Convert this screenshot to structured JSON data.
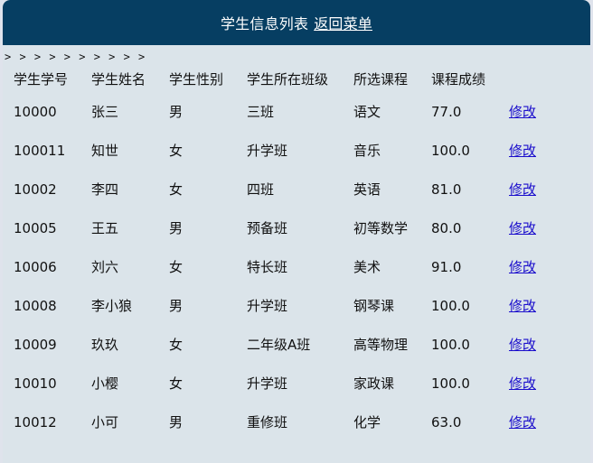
{
  "header": {
    "title": "学生信息列表",
    "back_link": "返回菜单"
  },
  "breadcrumb": "> > > > > > > > > >",
  "table": {
    "columns": [
      "学生学号",
      "学生姓名",
      "学生性别",
      "学生所在班级",
      "所选课程",
      "课程成绩"
    ],
    "edit_label": "修改",
    "rows": [
      {
        "id": "10000",
        "name": "张三",
        "sex": "男",
        "class": "三班",
        "course": "语文",
        "score": "77.0"
      },
      {
        "id": "100011",
        "name": "知世",
        "sex": "女",
        "class": "升学班",
        "course": "音乐",
        "score": "100.0"
      },
      {
        "id": "10002",
        "name": "李四",
        "sex": "女",
        "class": "四班",
        "course": "英语",
        "score": "81.0"
      },
      {
        "id": "10005",
        "name": "王五",
        "sex": "男",
        "class": "预备班",
        "course": "初等数学",
        "score": "80.0"
      },
      {
        "id": "10006",
        "name": "刘六",
        "sex": "女",
        "class": "特长班",
        "course": "美术",
        "score": "91.0"
      },
      {
        "id": "10008",
        "name": "李小狼",
        "sex": "男",
        "class": "升学班",
        "course": "钢琴课",
        "score": "100.0"
      },
      {
        "id": "10009",
        "name": "玖玖",
        "sex": "女",
        "class": "二年级A班",
        "course": "高等物理",
        "score": "100.0"
      },
      {
        "id": "10010",
        "name": "小樱",
        "sex": "女",
        "class": "升学班",
        "course": "家政课",
        "score": "100.0"
      },
      {
        "id": "10012",
        "name": "小可",
        "sex": "男",
        "class": "重修班",
        "course": "化学",
        "score": "63.0"
      }
    ]
  }
}
